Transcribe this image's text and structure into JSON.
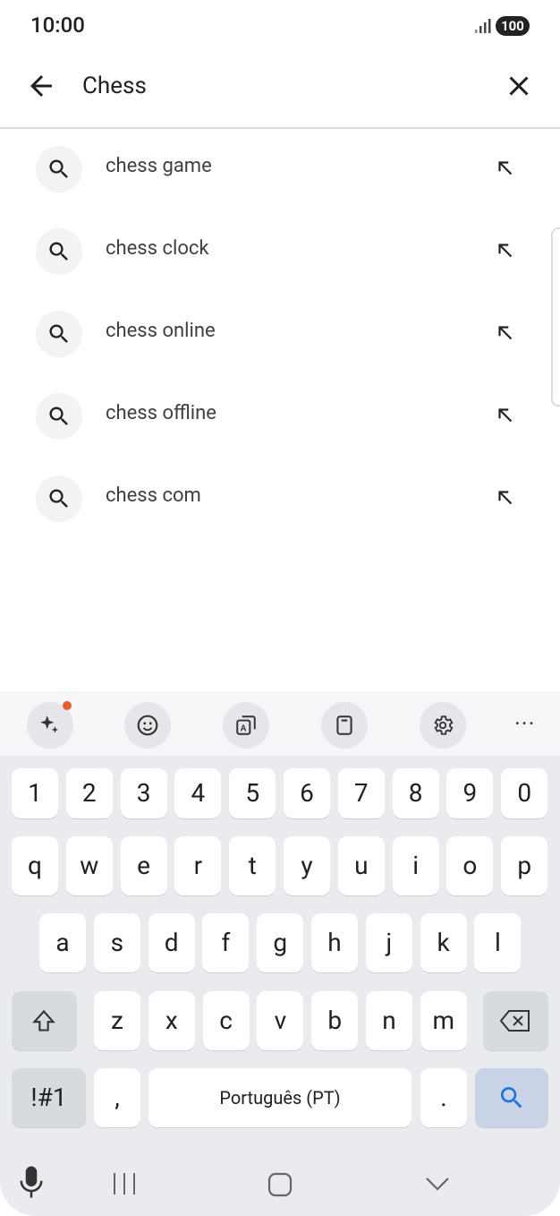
{
  "status_bar": {
    "time": "10:00",
    "battery": "100"
  },
  "search": {
    "query": "Chess"
  },
  "suggestions": [
    {
      "text": "chess game"
    },
    {
      "text": "chess clock"
    },
    {
      "text": "chess online"
    },
    {
      "text": "chess offline"
    },
    {
      "text": "chess com"
    }
  ],
  "keyboard": {
    "row_numbers": [
      "1",
      "2",
      "3",
      "4",
      "5",
      "6",
      "7",
      "8",
      "9",
      "0"
    ],
    "row1": [
      "q",
      "w",
      "e",
      "r",
      "t",
      "y",
      "u",
      "i",
      "o",
      "p"
    ],
    "row2": [
      "a",
      "s",
      "d",
      "f",
      "g",
      "h",
      "j",
      "k",
      "l"
    ],
    "row3": [
      "z",
      "x",
      "c",
      "v",
      "b",
      "n",
      "m"
    ],
    "symbols_label": "!#1",
    "comma": ",",
    "space_label": "Português (PT)",
    "period": "."
  },
  "colors": {
    "accent": "#1a73e8",
    "notification_dot": "#ef5a2a"
  }
}
